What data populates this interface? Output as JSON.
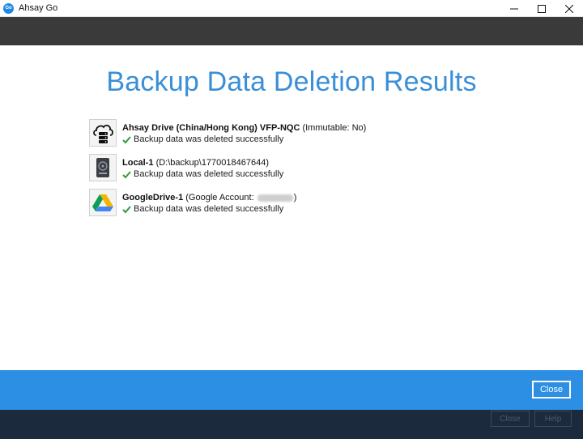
{
  "window": {
    "logo_text": "Go",
    "title": "Ahsay Go"
  },
  "page": {
    "title": "Backup Data Deletion Results"
  },
  "destinations": [
    {
      "name": "Ahsay Drive (China/Hong Kong) VFP-NQC",
      "detail": " (Immutable: No)",
      "status": "Backup data was deleted successfully",
      "icon": "cloud-server-icon"
    },
    {
      "name": "Local-1",
      "detail": " (D:\\backup\\1770018467644)",
      "status": "Backup data was deleted successfully",
      "icon": "local-drive-icon"
    },
    {
      "name": "GoogleDrive-1",
      "detail": " (Google Account: ",
      "detail_end": ")",
      "status": "Backup data was deleted successfully",
      "icon": "google-drive-icon"
    }
  ],
  "footer": {
    "close_label": "Close",
    "ghost_close_label": "Close",
    "ghost_help_label": "Help"
  },
  "colors": {
    "title_blue": "#3a8fd6",
    "footer_blue": "#2d8fe3",
    "check_green": "#2e9e3e"
  }
}
